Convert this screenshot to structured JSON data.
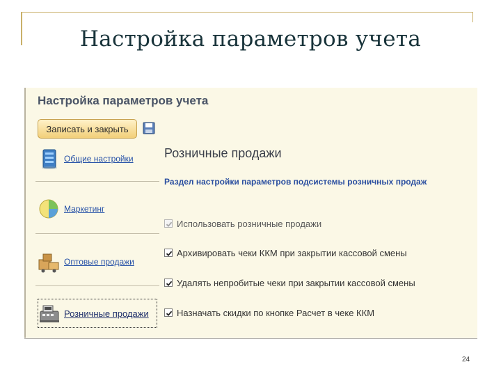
{
  "slide": {
    "title": "Настройка параметров учета",
    "page_number": "24"
  },
  "form": {
    "title": "Настройка параметров учета",
    "save_close_label": "Записать и закрыть"
  },
  "nav": {
    "items": [
      {
        "label": "Общие настройки",
        "icon": "general-settings-icon",
        "active": false
      },
      {
        "label": "Маркетинг",
        "icon": "marketing-icon",
        "active": false
      },
      {
        "label": "Оптовые продажи",
        "icon": "wholesale-icon",
        "active": false
      },
      {
        "label": "Розничные продажи",
        "icon": "cash-register-icon",
        "active": true
      }
    ]
  },
  "section": {
    "title": "Розничные продажи",
    "subtitle": "Раздел настройки параметров подсистемы розничных продаж",
    "options": [
      {
        "label": "Использовать розничные продажи",
        "checked": true,
        "disabled": true
      },
      {
        "label": "Архивировать чеки ККМ при закрытии кассовой смены",
        "checked": true,
        "disabled": false
      },
      {
        "label": "Удалять непробитые чеки при закрытии кассовой смены",
        "checked": true,
        "disabled": false
      },
      {
        "label": "Назначать скидки по кнопке Расчет в чеке ККМ",
        "checked": true,
        "disabled": false
      }
    ]
  },
  "colors": {
    "panel_background": "#fbf8e6",
    "link": "#2550a7",
    "accent_button": "#f2cf79"
  }
}
